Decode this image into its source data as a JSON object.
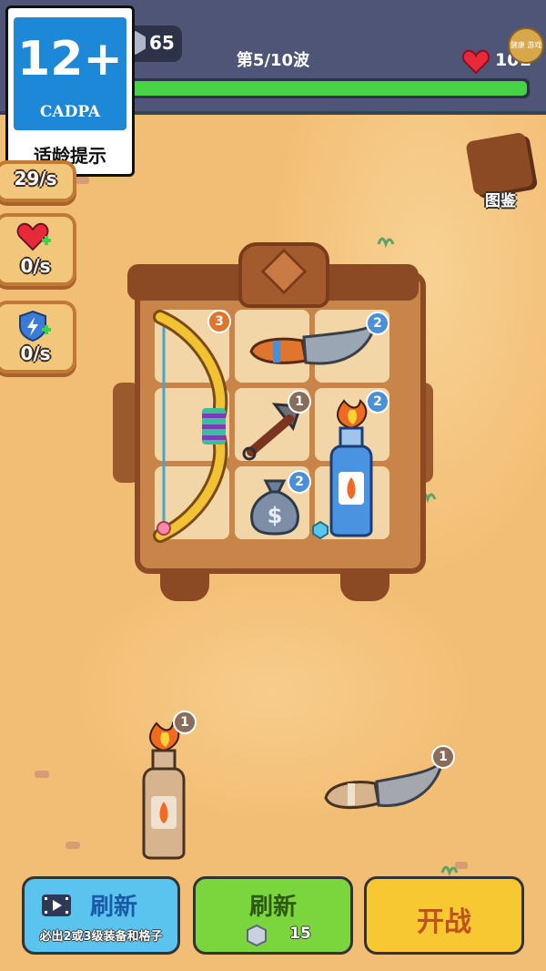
{
  "age_rating": {
    "age": "12+",
    "org": "CADPA",
    "tip": "适龄提示"
  },
  "header": {
    "gems": "65",
    "wave_text": "第5/10波",
    "hp": "101",
    "badge_text": "健康\n游戏",
    "wave_progress": 1.0
  },
  "side": {
    "income_rate": "29/s",
    "heal_rate": "0/s",
    "energy_rate": "0/s"
  },
  "atlas_label": "图鉴",
  "backpack_items": [
    {
      "name": "bow",
      "level": "3"
    },
    {
      "name": "knife",
      "level": "2"
    },
    {
      "name": "kunai",
      "level": "1"
    },
    {
      "name": "molotov",
      "level": "2"
    },
    {
      "name": "money-bag",
      "level": "2"
    }
  ],
  "ground_items": [
    {
      "name": "molotov",
      "level": "1"
    },
    {
      "name": "knife",
      "level": "1"
    }
  ],
  "buttons": {
    "ad_refresh": {
      "title": "刷新",
      "subtitle": "必出2或3级装备和格子"
    },
    "refresh": {
      "title": "刷新",
      "cost": "15"
    },
    "start": {
      "title": "开战"
    }
  },
  "colors": {
    "topbar": "#4f5577",
    "progress": "#48d247",
    "blue_btn": "#5ac3ee",
    "green_btn": "#7bd53c",
    "yellow_btn": "#f8c832"
  }
}
